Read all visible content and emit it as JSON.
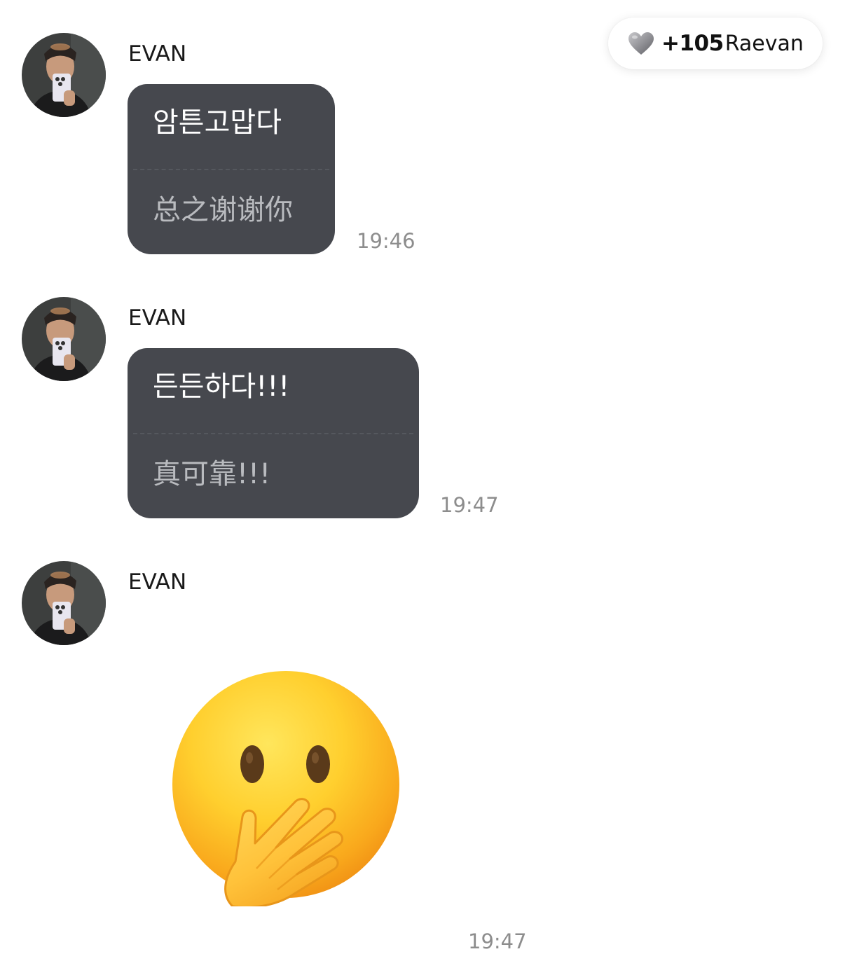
{
  "badge": {
    "icon": "heart-icon",
    "count": "+105",
    "name": "Raevan",
    "heart_color": "#8e8e93"
  },
  "messages": [
    {
      "sender": "EVAN",
      "original": "암튼고맙다",
      "translation": "总之谢谢你",
      "time": "19:46"
    },
    {
      "sender": "EVAN",
      "original": "든든하다!!!",
      "translation": "真可靠!!!",
      "time": "19:47"
    },
    {
      "sender": "EVAN",
      "sticker": "hand-over-mouth-emoji",
      "time": "19:47"
    }
  ],
  "colors": {
    "bubble": "#46484e",
    "bubble_text": "#ffffff",
    "translation_text": "#b9bbbf",
    "time_text": "#8d8d8d",
    "background": "#ffffff"
  }
}
